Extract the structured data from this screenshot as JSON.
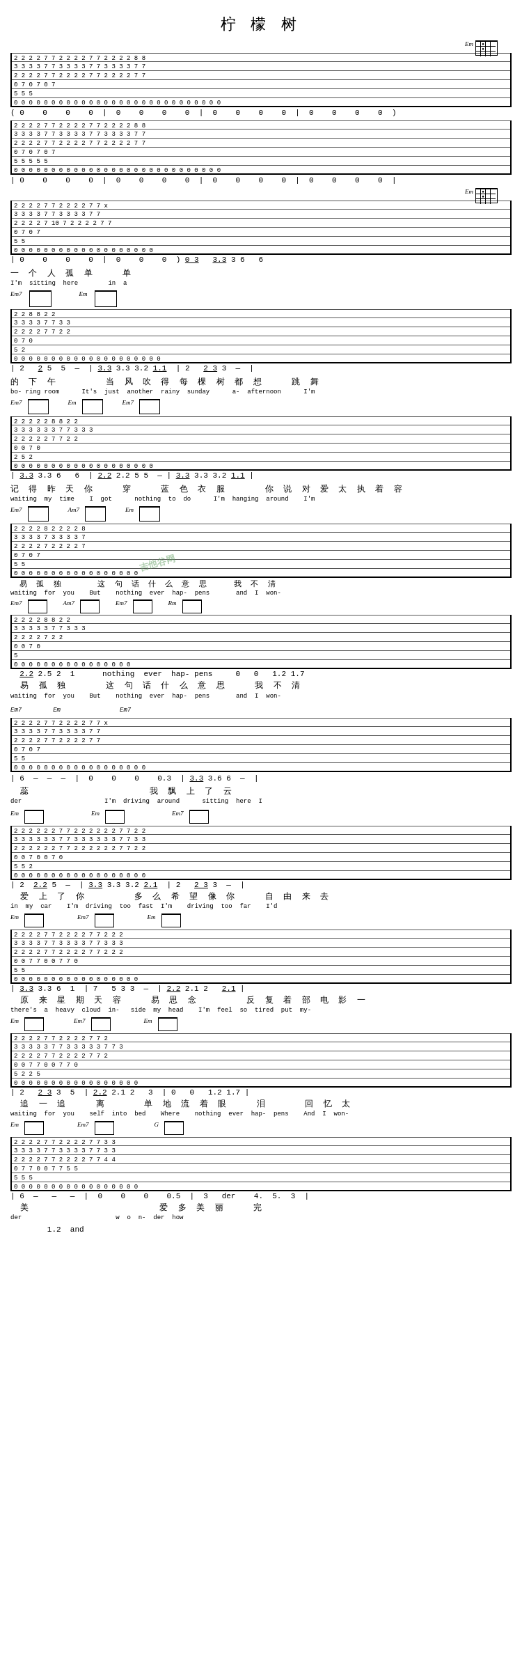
{
  "title": "柠 檬 树",
  "sections": [
    {
      "id": "section1",
      "chord_label_right": "Em",
      "tab_numbers": [
        "  2-2---2---2-----7---7-----2---2---2---2-----7---7-----2---2---2---2-----8---8---",
        "  3-3---3---3-----7---7-----3-3-3---3---3-----7---7-----3-3-3---3---3-----7---7---",
        "  2-2---2---2-----7---7-----2---2---2---2-----7---7-----2---2---2---2-----7---7---",
        "  0-0-----------  7---7-----0---0-----------  7---7-----0---0-----------  7---7---",
        "                  5---5-                      5---5-                      5---5-",
        "  0   0   0   0   0   0   0   0   0   0   0   0   0   0   0   0   0   0   0   0"
      ],
      "notes_row": "( 0    0    0    0  |  0    0    0    0  |  0    0    0    0  |  0    0    0    0  )"
    }
  ],
  "watermark": "吉他谷网"
}
